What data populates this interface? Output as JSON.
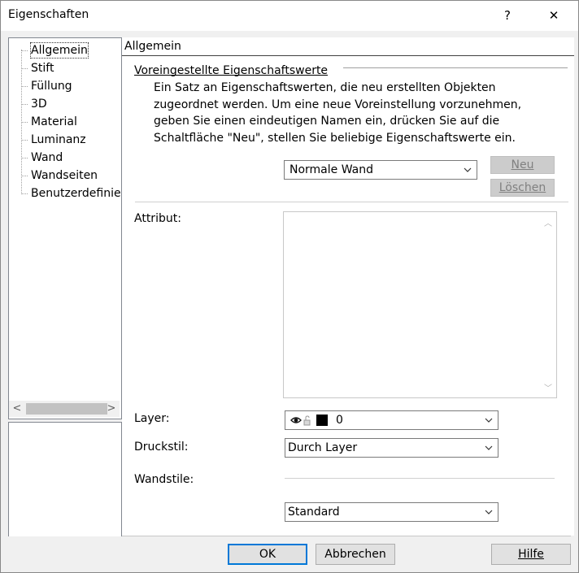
{
  "window": {
    "title": "Eigenschaften",
    "help_glyph": "?",
    "close_glyph": "✕"
  },
  "tree": {
    "items": [
      {
        "label": "Allgemein",
        "selected": true
      },
      {
        "label": "Stift"
      },
      {
        "label": "Füllung"
      },
      {
        "label": "3D"
      },
      {
        "label": "Material"
      },
      {
        "label": "Luminanz"
      },
      {
        "label": "Wand"
      },
      {
        "label": "Wandseiten"
      },
      {
        "label": "Benutzerdefinier"
      }
    ],
    "scroll_left": "<",
    "scroll_right": ">"
  },
  "panel": {
    "header": "Allgemein",
    "preset_group": "Voreingestellte Eigenschaftswerte",
    "description": "Ein Satz an Eigenschaftswerten, die neu erstellten Objekten zugeordnet werden. Um eine neue Voreinstellung vorzunehmen, geben Sie einen eindeutigen Namen ein, drücken Sie auf die Schaltfläche \"Neu\", stellen Sie beliebige Eigenschaftswerte ein.",
    "preset_value": "Normale Wand",
    "new_button": "Neu",
    "delete_button": "Löschen",
    "attribute_label": "Attribut:",
    "layer_label": "Layer:",
    "layer_value": "0",
    "print_style_label": "Druckstil:",
    "print_style_value": "Durch Layer",
    "wall_styles_label": "Wandstile:",
    "wall_style_value": "Standard"
  },
  "footer": {
    "ok": "OK",
    "cancel": "Abbrechen",
    "help": "Hilfe"
  },
  "colors": {
    "dialog_bg": "#f0f0f0",
    "default_button_border": "#0078d7",
    "layer_color_swatch": "#000000"
  }
}
